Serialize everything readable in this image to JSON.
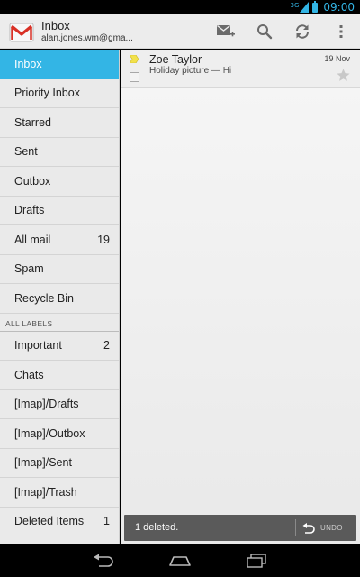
{
  "status_bar": {
    "network": "3G",
    "time": "09:00"
  },
  "action_bar": {
    "title": "Inbox",
    "account": "alan.jones.wm@gma...",
    "actions": [
      "compose-icon",
      "search-icon",
      "refresh-icon",
      "overflow-menu-icon"
    ]
  },
  "sidebar": {
    "items": [
      {
        "label": "Inbox",
        "count": ""
      },
      {
        "label": "Priority Inbox",
        "count": ""
      },
      {
        "label": "Starred",
        "count": ""
      },
      {
        "label": "Sent",
        "count": ""
      },
      {
        "label": "Outbox",
        "count": ""
      },
      {
        "label": "Drafts",
        "count": ""
      },
      {
        "label": "All mail",
        "count": "19"
      },
      {
        "label": "Spam",
        "count": ""
      },
      {
        "label": "Recycle Bin",
        "count": ""
      }
    ],
    "labels_header": "ALL LABELS",
    "labels": [
      {
        "label": "Important",
        "count": "2"
      },
      {
        "label": "Chats",
        "count": ""
      },
      {
        "label": "[Imap]/Drafts",
        "count": ""
      },
      {
        "label": "[Imap]/Outbox",
        "count": ""
      },
      {
        "label": "[Imap]/Sent",
        "count": ""
      },
      {
        "label": "[Imap]/Trash",
        "count": ""
      },
      {
        "label": "Deleted Items",
        "count": "1"
      }
    ]
  },
  "messages": [
    {
      "sender": "Zoe Taylor",
      "subject": "Holiday picture",
      "snippet": " — Hi",
      "date": "19 Nov",
      "starred": false
    }
  ],
  "undo_bar": {
    "message": "1 deleted.",
    "action": "UNDO"
  },
  "colors": {
    "accent": "#33b5e5"
  }
}
